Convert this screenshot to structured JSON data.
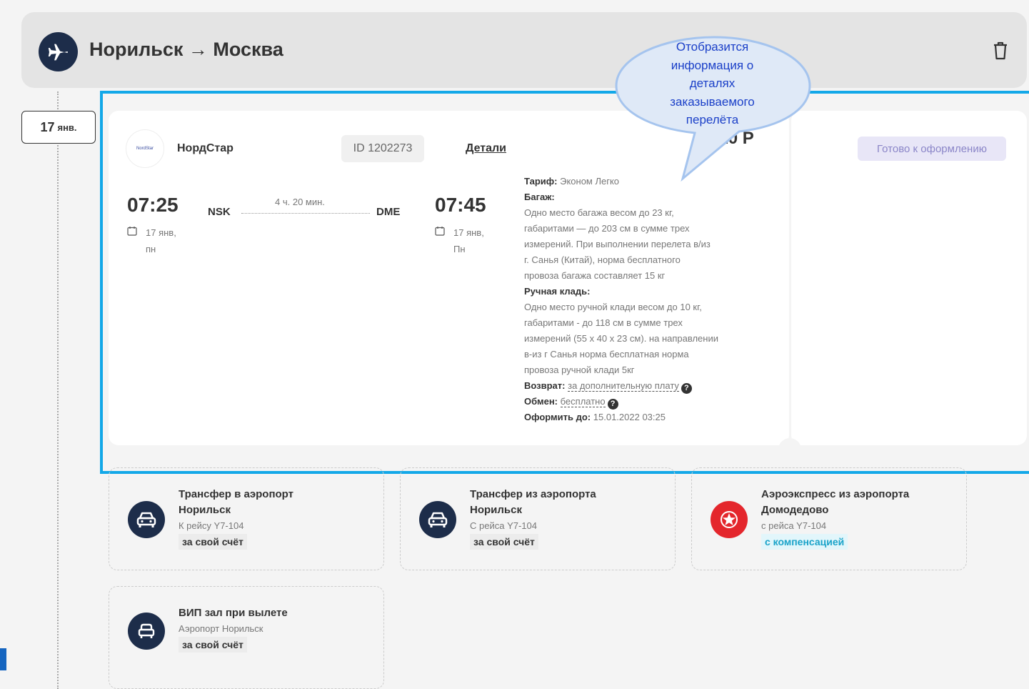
{
  "route": {
    "title": "Норильск → Москва"
  },
  "date_badge": {
    "day": "17",
    "month": "янв."
  },
  "flight": {
    "airline_logo_text": "NordStar",
    "airline": "НордСтар",
    "id": "ID 1202273",
    "details_link": "Детали",
    "price": "710 Р",
    "status": "Готово к оформлению",
    "departure": {
      "time": "07:25",
      "code": "NSK",
      "date": "17 янв,",
      "weekday": "пн"
    },
    "arrival": {
      "time": "07:45",
      "code": "DME",
      "date": "17 янв,",
      "weekday": "Пн"
    },
    "duration": "4 ч. 20 мин."
  },
  "fare": {
    "tariff_label": "Тариф:",
    "tariff_value": "Эконом Легко",
    "baggage_label": "Багаж:",
    "baggage_lines": [
      "Одно место багажа весом до 23 кг,",
      "габаритами — до 203 см в сумме трех",
      "измерений. При выполнении перелета в/из",
      "г. Санья (Китай), норма бесплатного",
      "провоза багажа составляет 15 кг"
    ],
    "hand_label": "Ручная кладь:",
    "hand_lines": [
      "Одно место ручной клади весом до 10 кг,",
      "габаритами - до 118 см в сумме трех",
      "измерений (55 х 40 х 23 см). на направлении",
      "в-из г Санья норма бесплатная норма",
      "провоза ручной клади 5кг"
    ],
    "refund_label": "Возврат:",
    "refund_value": "за дополнительную плату",
    "exchange_label": "Обмен:",
    "exchange_value": "бесплатно",
    "deadline_label": "Оформить до:",
    "deadline_value": "15.01.2022 03:25",
    "help_glyph": "?"
  },
  "callout": {
    "lines": [
      "Отобразится",
      "информация о",
      "деталях",
      "заказываемого",
      "перелёта"
    ]
  },
  "services": [
    {
      "icon": "car-icon",
      "title1": "Трансфер в аэропорт",
      "title2": "Норильск",
      "sub": "К рейсу Y7-104",
      "tag": "за свой счёт"
    },
    {
      "icon": "car-icon",
      "title1": "Трансфер из аэропорта",
      "title2": "Норильск",
      "sub": "С рейса Y7-104",
      "tag": "за свой счёт"
    },
    {
      "icon": "aeroexpress-icon",
      "title1": "Аэроэкспресс из аэропорта",
      "title2": "Домодедово",
      "sub": "с рейса Y7-104",
      "tag": "с компенсацией"
    },
    {
      "icon": "vip-lounge-icon",
      "title1": "ВИП зал при вылете",
      "title2": "",
      "sub": "Аэропорт Норильск",
      "tag": "за свой счёт"
    }
  ],
  "colors": {
    "highlight": "#13a8e8",
    "navy": "#1d2d4a",
    "red": "#e4262c",
    "callout_text": "#1a3fc8"
  }
}
